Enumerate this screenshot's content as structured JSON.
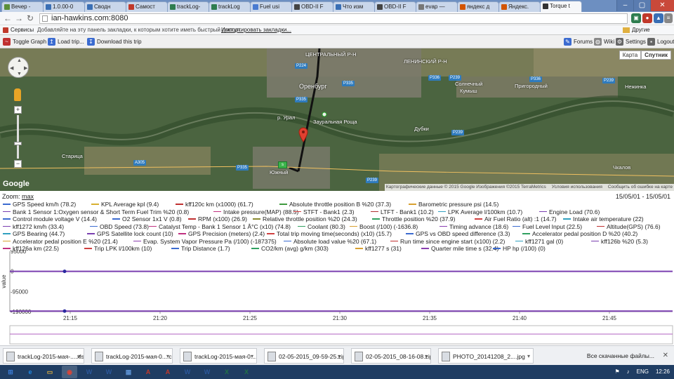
{
  "browser": {
    "tabs": [
      {
        "label": "Вечер -",
        "color": "#5b8f3a"
      },
      {
        "label": "1.0.00-0",
        "color": "#3a6fb5"
      },
      {
        "label": "Сводн",
        "color": "#3a6fb5"
      },
      {
        "label": "Самост",
        "color": "#c0392b"
      },
      {
        "label": "trackLog-",
        "color": "#2e7d4f"
      },
      {
        "label": "trackLog",
        "color": "#2e7d4f"
      },
      {
        "label": "Fuel usi",
        "color": "#4a7bd1"
      },
      {
        "label": "OBD-II F",
        "color": "#444444"
      },
      {
        "label": "Что изм",
        "color": "#3a6fb5"
      },
      {
        "label": "OBD-II F",
        "color": "#444444"
      },
      {
        "label": "evap —",
        "color": "#777777"
      },
      {
        "label": "яндекс д",
        "color": "#d35400"
      },
      {
        "label": "Яндекс.",
        "color": "#d35400"
      },
      {
        "label": "Torque t",
        "color": "#333333"
      }
    ],
    "url": "ian-hawkins.com:8080",
    "bookmarks_label": "Сервисы",
    "bookmarks_hint": "Добавляйте на эту панель закладки, к которым хотите иметь быстрый доступ.",
    "bookmarks_import": "Импортировать закладки...",
    "other_bookmarks": "Другие закладки"
  },
  "toolbar": {
    "toggle_graph": "Toggle Graph",
    "load_trip": "Load trip...",
    "download_trip": "Download this trip",
    "forums": "Forums",
    "wiki": "Wiki",
    "settings": "Settings",
    "logout": "Logout"
  },
  "map": {
    "type_map": "Карта",
    "type_sat": "Спутник",
    "google": "Google",
    "attribution": "Картографические данные © 2015 Google Изображения ©2015 TerraMetrics",
    "terms": "Условия использования",
    "report": "Сообщить об ошибке на карте",
    "places": [
      {
        "name": "ЦЕНТРАЛЬНЫЙ Р-Н"
      },
      {
        "name": "ЛЕНИНСКИЙ Р-Н"
      },
      {
        "name": "Оренбург"
      },
      {
        "name": "Старица"
      },
      {
        "name": "Дубки"
      },
      {
        "name": "Пригородный"
      },
      {
        "name": "Солнечный"
      },
      {
        "name": "Нежинка"
      },
      {
        "name": "Чкалов"
      },
      {
        "name": "Зауральная Роща"
      },
      {
        "name": "Южный"
      },
      {
        "name": "р. Урал"
      },
      {
        "name": "Кумыш"
      }
    ],
    "roads": [
      "P224",
      "P335",
      "P336",
      "P239",
      "P239",
      "P335",
      "P239",
      "P336",
      "A305",
      "P335",
      "P239"
    ]
  },
  "chart": {
    "zoom_label": "Zoom:",
    "zoom_link": "max",
    "date_range": "15/05/01 - 15/05/01",
    "ylabel": "value",
    "yticks": [
      "95000",
      "0",
      "-95000",
      "-190000"
    ],
    "xticks": [
      "21:15",
      "21:20",
      "21:25",
      "21:30",
      "21:35",
      "21:40",
      "21:45"
    ],
    "legend": [
      {
        "label": "GPS Speed km/h (78.2)",
        "color": "#3b6bd0"
      },
      {
        "label": "KPL Average kpl (9.4)",
        "color": "#d8b030"
      },
      {
        "label": "kff120c km (x1000) (61.7)",
        "color": "#c03030"
      },
      {
        "label": "Absolute throttle position B %20 (37.3)",
        "color": "#3f9a3f"
      },
      {
        "label": "Barometric pressure psi (14.5)",
        "color": "#d8a030"
      },
      {
        "label": "Bank 1 Sensor 1:Oxygen sensor & Short Term Fuel Trim %20 (0.8)",
        "color": "#7a3fb0"
      },
      {
        "label": "Intake pressure(MAP) (88.5)",
        "color": "#c03080"
      },
      {
        "label": "STFT - Bank1 (2.3)",
        "color": "#d04040"
      },
      {
        "label": "LTFT - Bank1 (10.2)",
        "color": "#b03030"
      },
      {
        "label": "LPK Average l/100km (10.7)",
        "color": "#30a0c0"
      },
      {
        "label": "Engine Load (70.6)",
        "color": "#7a3fb0"
      },
      {
        "label": "Control module voltage V (14.4)",
        "color": "#3b6bd0"
      },
      {
        "label": "O2 Sensor 1x1 V (0.8)",
        "color": "#3b6bd0"
      },
      {
        "label": "RPM (x100) (26.9)",
        "color": "#c03030"
      },
      {
        "label": "Relative throttle position %20 (24.3)",
        "color": "#8a8a30"
      },
      {
        "label": "Throttle position %20 (37.9)",
        "color": "#30a060"
      },
      {
        "label": "Air Fuel Ratio (alt) :1 (14.7)",
        "color": "#d04040"
      },
      {
        "label": "Intake air temperature (22)",
        "color": "#30a0c0"
      },
      {
        "label": "kff1272 km/h (33.4)",
        "color": "#7a3fb0"
      },
      {
        "label": "OBD Speed (73.8)",
        "color": "#3b6bd0"
      },
      {
        "label": "Catalyst Temp - Bank 1 Sensor 1 Â°C (x10) (74.8)",
        "color": "#c03080"
      },
      {
        "label": "Coolant (80.3)",
        "color": "#30a060"
      },
      {
        "label": "Boost (/100) (-1636.8)",
        "color": "#d8a030"
      },
      {
        "label": "Timing advance (18.6)",
        "color": "#8a3fb0"
      },
      {
        "label": "Fuel Level Input (22.5)",
        "color": "#3b6bd0"
      },
      {
        "label": "Altitude(GPS) (76.6)",
        "color": "#c03030"
      },
      {
        "label": "GPS Bearing (44.7)",
        "color": "#30a0c0"
      },
      {
        "label": "GPS Satellite lock count (10)",
        "color": "#7a3fb0"
      },
      {
        "label": "GPS Precision (meters) (2.4)",
        "color": "#c03080"
      },
      {
        "label": "Total trip moving time(seconds) (x10) (15.7)",
        "color": "#d04040"
      },
      {
        "label": "GPS vs OBD speed difference (3.3)",
        "color": "#3b6bd0"
      },
      {
        "label": "Accelerator pedal position D %20 (40.2)",
        "color": "#30a060"
      },
      {
        "label": "Accelerator pedal position E %20 (21.4)",
        "color": "#d8a030"
      },
      {
        "label": "Evap. System Vapor Pressure Pa (/100) (-187375)",
        "color": "#8a3fb0"
      },
      {
        "label": "Absolute load value %20 (67.1)",
        "color": "#3b6bd0"
      },
      {
        "label": "Run time since engine start (x100) (2.2)",
        "color": "#c03030"
      },
      {
        "label": "kff1271 gal (0)",
        "color": "#30a0c0"
      },
      {
        "label": "kff126b %20 (5.3)",
        "color": "#7a3fb0"
      },
      {
        "label": "kff126a km (22.5)",
        "color": "#c03080"
      },
      {
        "label": "Trip LPK l/100km (10)",
        "color": "#d04040"
      },
      {
        "label": "Trip Distance (1.7)",
        "color": "#3b6bd0"
      },
      {
        "label": "CO2/km (avg) g/km (303)",
        "color": "#30a060"
      },
      {
        "label": "kff1277 s (31)",
        "color": "#d8a030"
      },
      {
        "label": "Quarter mile time s (32.4)",
        "color": "#8a3fb0"
      },
      {
        "label": "HP hp (/100) (0)",
        "color": "#3b6bd0"
      }
    ]
  },
  "chart_data": {
    "type": "line",
    "ylabel": "value",
    "ylim": [
      -190000,
      95000
    ],
    "x": [
      "21:15",
      "21:20",
      "21:25",
      "21:30",
      "21:35",
      "21:40",
      "21:45"
    ],
    "series": [
      {
        "name": "Boost (/100) (-1636.8)",
        "values": [
          0,
          0,
          0,
          0,
          0,
          0,
          0
        ]
      },
      {
        "name": "Evap. System Vapor Pressure Pa (/100) (-187375)",
        "values": [
          -187375,
          -187375,
          -187375,
          -187375,
          -187375,
          -187375,
          -187375
        ]
      }
    ]
  },
  "downloads": [
    {
      "label": "trackLog-2015-мая-....xlsb"
    },
    {
      "label": "trackLog-2015-мая-0....c..."
    },
    {
      "label": "trackLog-2015-мая-0....c..."
    },
    {
      "label": "02-05-2015_09-59-25.zip"
    },
    {
      "label": "02-05-2015_08-16-08.zip"
    },
    {
      "label": "PHOTO_20141208_2....jpg"
    }
  ],
  "downloads_all": "Все скачанные файлы...",
  "taskbar": {
    "apps": [
      "start",
      "ie",
      "explorer",
      "chrome",
      "word",
      "word2",
      "photos",
      "acrobat",
      "acrobat2",
      "word3",
      "word4",
      "excel",
      "excel2"
    ],
    "lang": "ENG",
    "time": "12:26"
  }
}
